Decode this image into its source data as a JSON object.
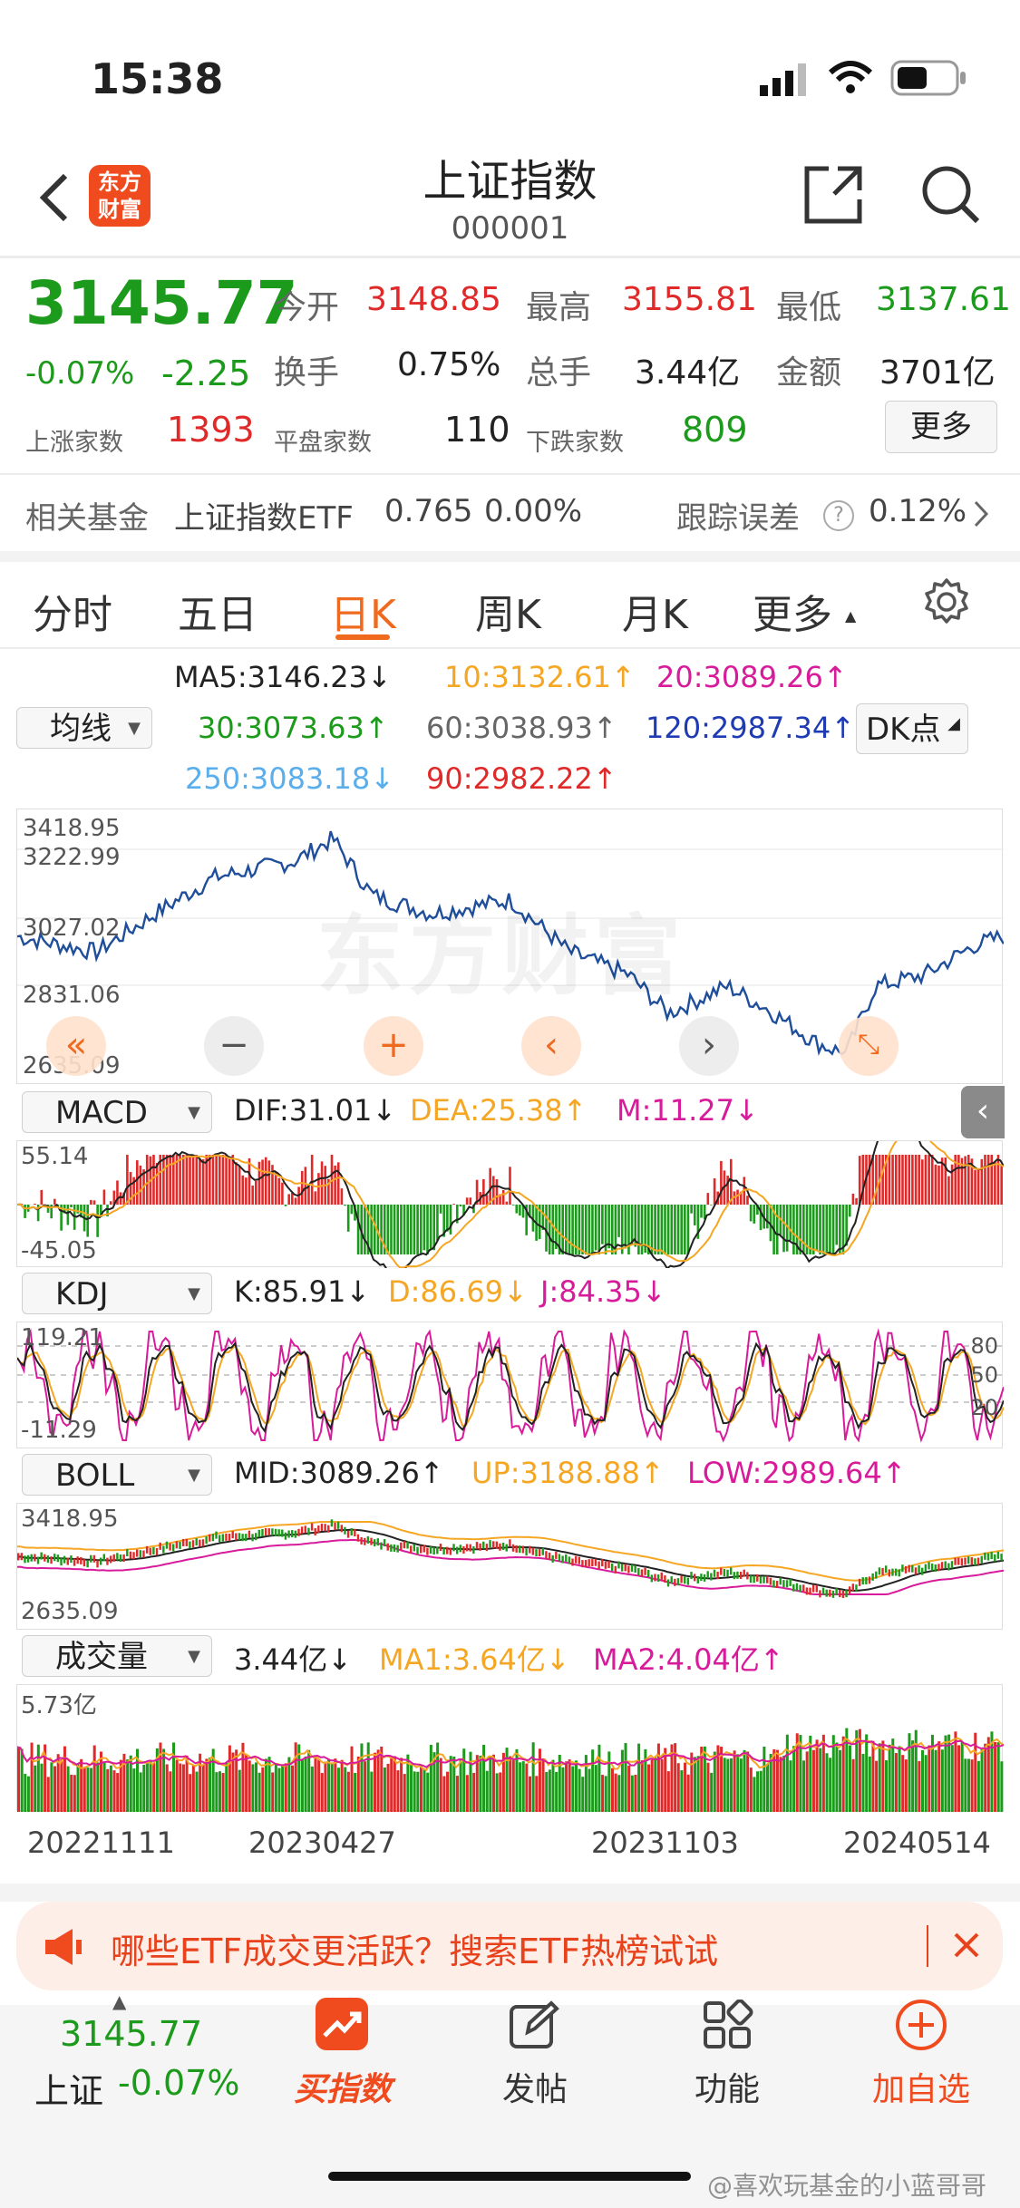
{
  "status_bar": {
    "time": "15:38"
  },
  "header": {
    "title": "上证指数",
    "code": "000001",
    "logo_text_1": "东方",
    "logo_text_2": "财富"
  },
  "quote": {
    "price": "3145.77",
    "pct": "-0.07%",
    "change": "-2.25",
    "open_label": "今开",
    "open": "3148.85",
    "high_label": "最高",
    "high": "3155.81",
    "low_label": "最低",
    "low": "3137.61",
    "turnover_label": "换手",
    "turnover": "0.75%",
    "volume_label": "总手",
    "volume": "3.44亿",
    "amount_label": "金额",
    "amount": "3701亿",
    "up_label": "上涨家数",
    "up": "1393",
    "flat_label": "平盘家数",
    "flat": "110",
    "down_label": "下跌家数",
    "down": "809",
    "more_button": "更多"
  },
  "fund": {
    "label": "相关基金",
    "name": "上证指数ETF",
    "price": "0.765",
    "pct": "0.00%",
    "track_label": "跟踪误差",
    "track_value": "0.12%"
  },
  "tabs": [
    "分时",
    "五日",
    "日K",
    "周K",
    "月K",
    "更多"
  ],
  "active_tab": "日K",
  "ma": {
    "select": "均线",
    "ma5": "MA5:3146.23↓",
    "ma10": "10:3132.61↑",
    "ma20": "20:3089.26↑",
    "ma30": "30:3073.63↑",
    "ma60": "60:3038.93↑",
    "ma120": "120:2987.34↑",
    "ma250": "250:3083.18↓",
    "ma90": "90:2982.22↑",
    "dk_button": "DK点"
  },
  "main_chart": {
    "y_labels": [
      "3418.95",
      "3222.99",
      "3027.02",
      "2831.06",
      "2635.09"
    ],
    "watermark": "东方财富"
  },
  "macd": {
    "select": "MACD",
    "dif": "DIF:31.01↓",
    "dea": "DEA:25.38↑",
    "m": "M:11.27↓",
    "top": "55.14",
    "bottom": "-45.05"
  },
  "kdj": {
    "select": "KDJ",
    "k": "K:85.91↓",
    "d": "D:86.69↓",
    "j": "J:84.35↓",
    "top": "119.21",
    "bottom": "-11.29",
    "levels": [
      "80",
      "50",
      "20"
    ]
  },
  "boll": {
    "select": "BOLL",
    "mid": "MID:3089.26↑",
    "up": "UP:3188.88↑",
    "low": "LOW:2989.64↑",
    "top": "3418.95",
    "bottom": "2635.09"
  },
  "vol": {
    "select": "成交量",
    "value": "3.44亿↓",
    "ma1": "MA1:3.64亿↓",
    "ma2": "MA2:4.04亿↑",
    "top": "5.73亿"
  },
  "dates": [
    "20221111",
    "20230427",
    "20231103",
    "20240514"
  ],
  "banner": {
    "text": "哪些ETF成交更活跃？搜索ETF热榜试试"
  },
  "bottom_nav": {
    "price": "3145.77",
    "name": "上证",
    "pct": "-0.07%",
    "items": [
      "买指数",
      "发帖",
      "功能",
      "加自选"
    ]
  },
  "watermark_text": "@喜欢玩基金的小蓝哥哥",
  "colors": {
    "up": "#e02a2a",
    "down": "#1b9a1b",
    "accent": "#ef6a1f",
    "line": "#1f4e9a"
  }
}
